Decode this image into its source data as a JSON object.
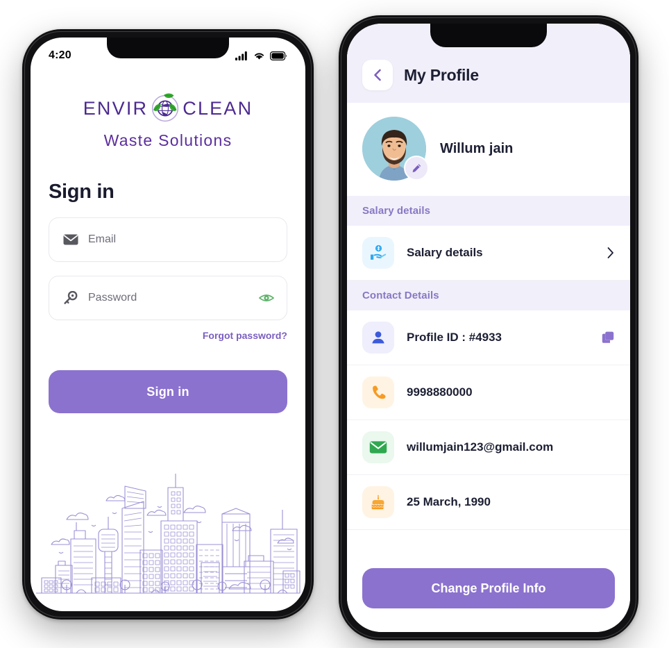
{
  "colors": {
    "accent_purple": "#8b72ce",
    "logo_purple": "#4c2a91",
    "leaf_green": "#36a832",
    "section_bg": "#f1effa",
    "section_text": "#8878c4",
    "text_dark": "#1c1f33",
    "eye_green": "#5db36a",
    "city_line": "#9b8fd4"
  },
  "signin_screen": {
    "status": {
      "time": "4:20",
      "signal_icon": "signal-bars-icon",
      "wifi_icon": "wifi-icon",
      "battery_icon": "battery-icon"
    },
    "logo": {
      "word_left": "ENVIR",
      "word_right": "CLEAN",
      "emblem_icon": "globe-leaves-recycle-icon",
      "subtitle": "Waste Solutions"
    },
    "title": "Sign in",
    "email_field": {
      "icon": "envelope-icon",
      "placeholder": "Email",
      "value": ""
    },
    "password_field": {
      "icon": "key-icon",
      "placeholder": "Password",
      "value": "",
      "toggle_icon": "eye-icon"
    },
    "forgot_label": "Forgot password?",
    "submit_label": "Sign in",
    "illustration": "city-skyline-illustration"
  },
  "profile_screen": {
    "header": {
      "back_icon": "chevron-left-icon",
      "title": "My Profile"
    },
    "user": {
      "avatar_icon": "user-photo-avatar",
      "name": "Willum jain",
      "edit_icon": "pencil-edit-icon"
    },
    "salary_section": {
      "heading": "Salary details",
      "row": {
        "icon": "hand-holding-coin-icon",
        "label": "Salary details",
        "chevron_icon": "chevron-right-icon"
      }
    },
    "contact_section": {
      "heading": "Contact Details",
      "rows": [
        {
          "icon": "person-icon",
          "value": "Profile ID : #4933",
          "action_icon": "copy-icon"
        },
        {
          "icon": "phone-icon",
          "value": "9998880000",
          "action_icon": ""
        },
        {
          "icon": "envelope-icon",
          "value": "willumjain123@gmail.com",
          "action_icon": ""
        },
        {
          "icon": "birthday-cake-icon",
          "value": "25 March, 1990",
          "action_icon": ""
        }
      ]
    },
    "change_button_label": "Change Profile Info"
  }
}
